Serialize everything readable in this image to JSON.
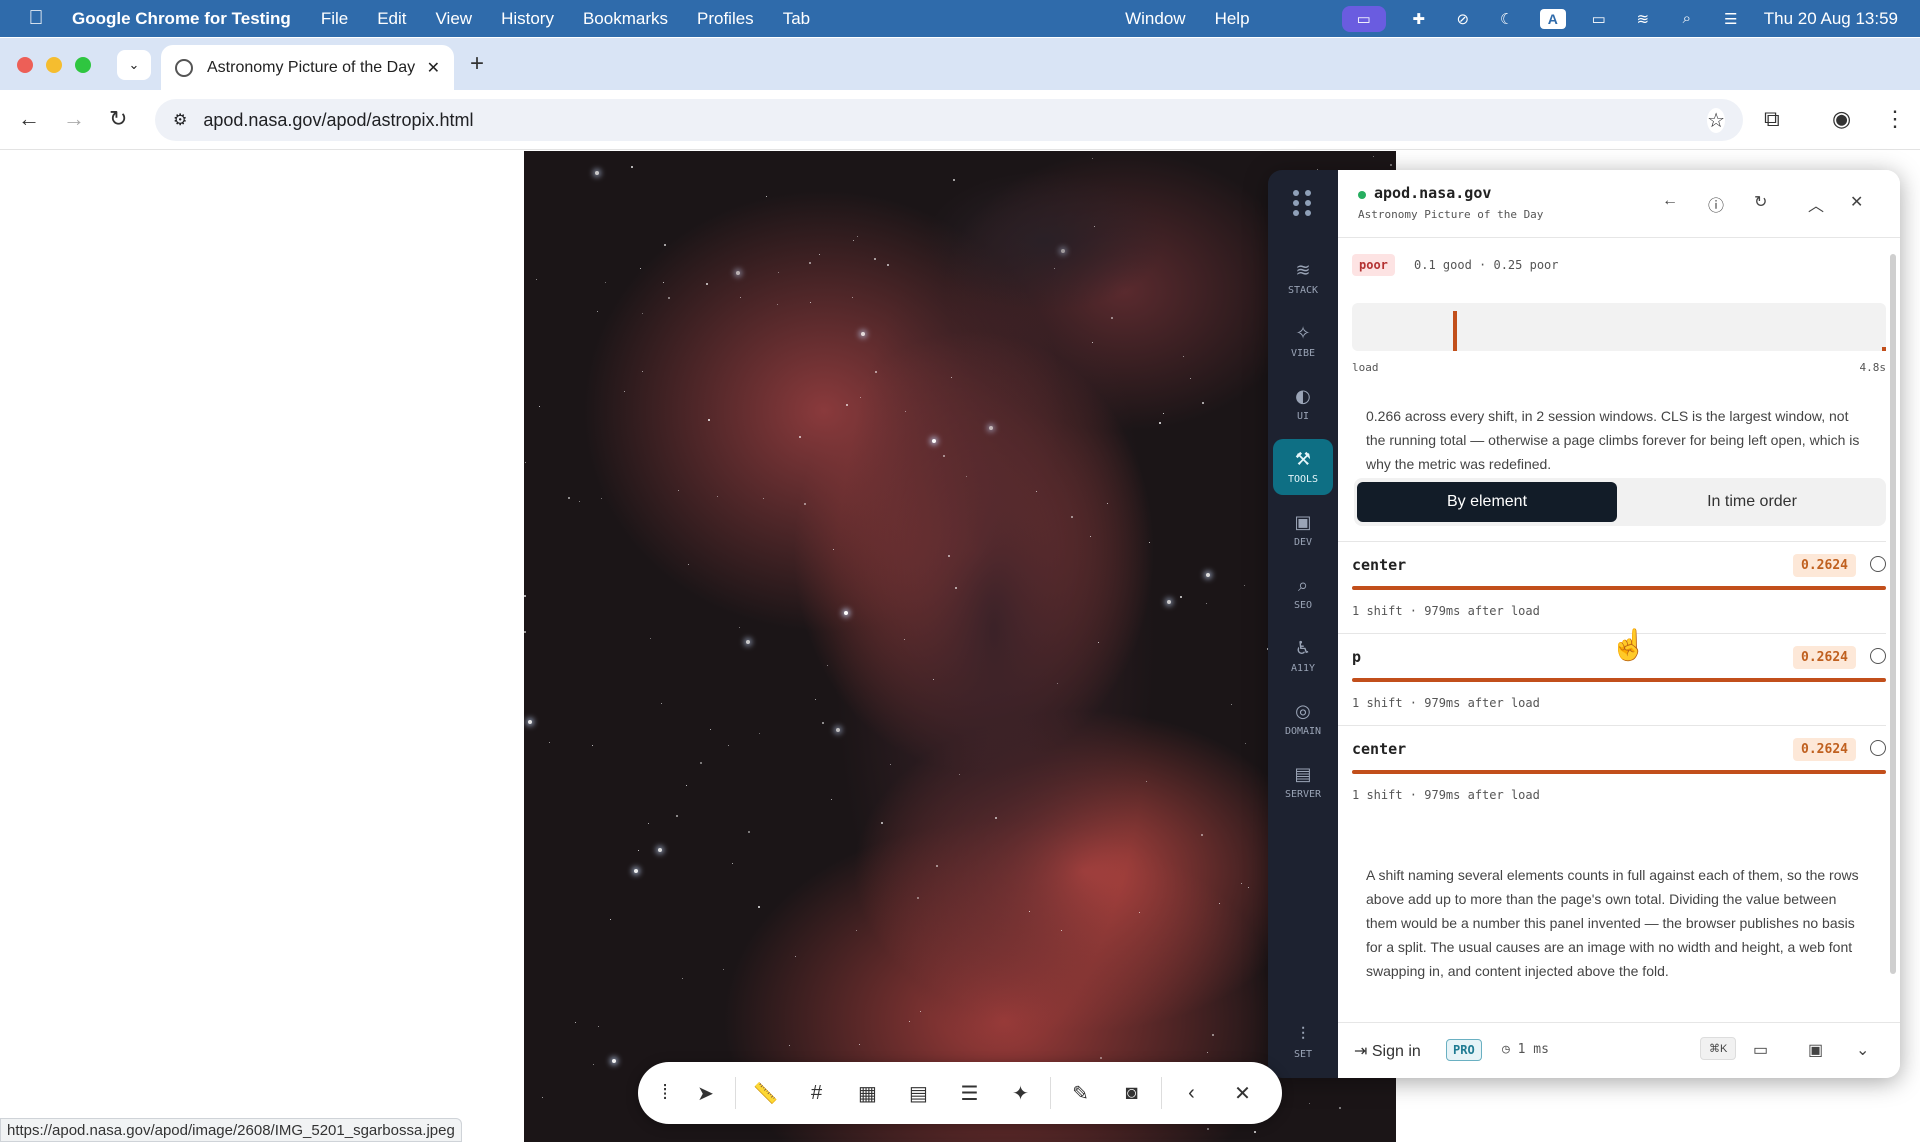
{
  "menubar": {
    "app_name": "Google Chrome for Testing",
    "items": [
      "File",
      "Edit",
      "View",
      "History",
      "Bookmarks",
      "Profiles",
      "Tab",
      "Window",
      "Help"
    ],
    "datetime": "Thu 20 Aug  13:59",
    "input_badge": "A"
  },
  "tab": {
    "title": "Astronomy Picture of the Day"
  },
  "omnibox": {
    "url": "apod.nasa.gov/apod/astropix.html"
  },
  "panel": {
    "domain": "apod.nasa.gov",
    "subtitle": "Astronomy Picture of the Day",
    "rail": [
      {
        "label": "STACK",
        "icon": "stack-icon"
      },
      {
        "label": "VIBE",
        "icon": "sparkle-icon"
      },
      {
        "label": "UI",
        "icon": "palette-icon"
      },
      {
        "label": "TOOLS",
        "icon": "wrench-icon",
        "active": true
      },
      {
        "label": "DEV",
        "icon": "terminal-icon"
      },
      {
        "label": "SEO",
        "icon": "search-icon"
      },
      {
        "label": "A11Y",
        "icon": "accessibility-icon"
      },
      {
        "label": "DOMAIN",
        "icon": "globe-icon"
      },
      {
        "label": "SERVER",
        "icon": "server-icon"
      },
      {
        "label": "SET",
        "icon": "sliders-icon"
      }
    ],
    "rating": "poor",
    "thresholds": "0.1 good · 0.25 poor",
    "timeline": {
      "start_label": "load",
      "end_label": "4.8s",
      "marker_fraction": 0.19
    },
    "summary": "0.266 across every shift, in 2 session windows. CLS is the largest window, not the running total — otherwise a page climbs forever for being left open, which is why the metric was redefined.",
    "toggle": {
      "by_element": "By element",
      "in_time_order": "In time order"
    },
    "rows": [
      {
        "selector": "center",
        "value": "0.2624",
        "meta": "1 shift · 979ms after load"
      },
      {
        "selector": "p",
        "value": "0.2624",
        "meta": "1 shift · 979ms after load"
      },
      {
        "selector": "center",
        "value": "0.2624",
        "meta": "1 shift · 979ms after load"
      }
    ],
    "note": "A shift naming several elements counts in full against each of them, so the rows above add up to more than the page's own total. Dividing the value between them would be a number this panel invented — the browser publishes no basis for a split. The usual causes are an image with no width and height, a web font swapping in, and content injected above the fold.",
    "footer": {
      "sign_in": "Sign in",
      "pro": "PRO",
      "timing": "1 ms",
      "shortcut": "⌘K"
    }
  },
  "status_bar": {
    "url": "https://apod.nasa.gov/apod/image/2608/IMG_5201_sgarbossa.jpeg"
  },
  "colors": {
    "accent": "#0e6f84",
    "shift_bar": "#c24f1b",
    "menubar": "#2f6bab"
  }
}
